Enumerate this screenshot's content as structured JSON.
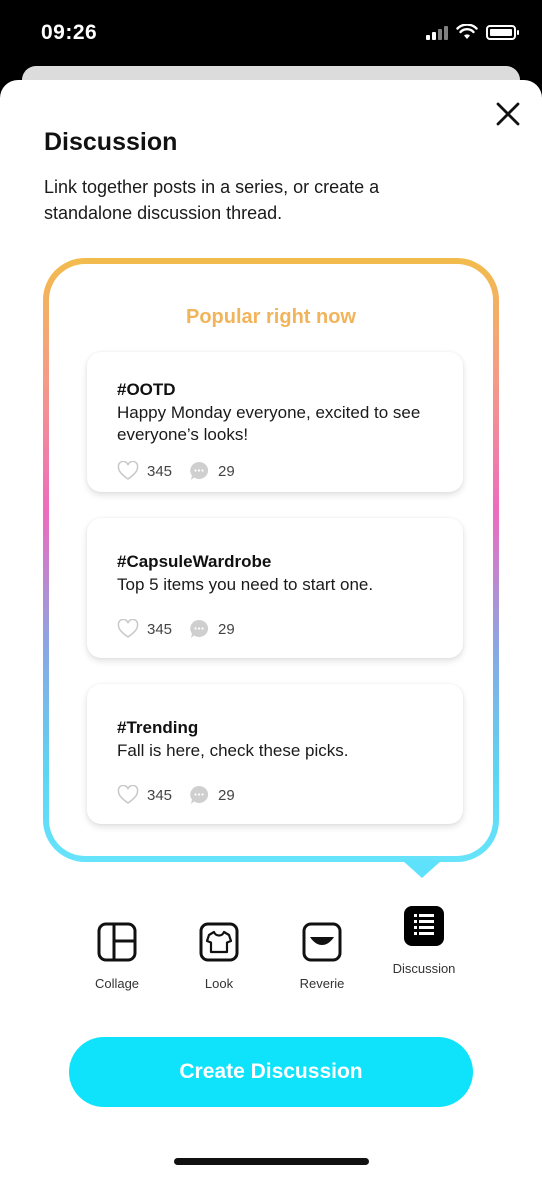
{
  "status_bar": {
    "time": "09:26"
  },
  "sheet": {
    "title": "Discussion",
    "description": "Link together posts in a series, or create a standalone discussion thread."
  },
  "popular": {
    "title": "Popular right now",
    "posts": [
      {
        "tag": "#OOTD",
        "text": "Happy Monday everyone, excited to see everyone’s looks!",
        "likes": "345",
        "comments": "29"
      },
      {
        "tag": "#CapsuleWardrobe",
        "text": "Top 5 items you need to start one.",
        "likes": "345",
        "comments": "29"
      },
      {
        "tag": "#Trending",
        "text": "Fall is here, check these picks.",
        "likes": "345",
        "comments": "29"
      }
    ]
  },
  "types": [
    {
      "label": "Collage",
      "icon": "collage-icon"
    },
    {
      "label": "Look",
      "icon": "shirt-icon"
    },
    {
      "label": "Reverie",
      "icon": "reverie-icon"
    },
    {
      "label": "Discussion",
      "icon": "discussion-list-icon",
      "selected": true
    }
  ],
  "create_button": {
    "label": "Create Discussion"
  },
  "colors": {
    "accent": "#0ee3fb",
    "popular_title": "#f2b45a",
    "gradient": [
      "#f2bc4c",
      "#ee6bbe",
      "#66e4fb"
    ]
  }
}
